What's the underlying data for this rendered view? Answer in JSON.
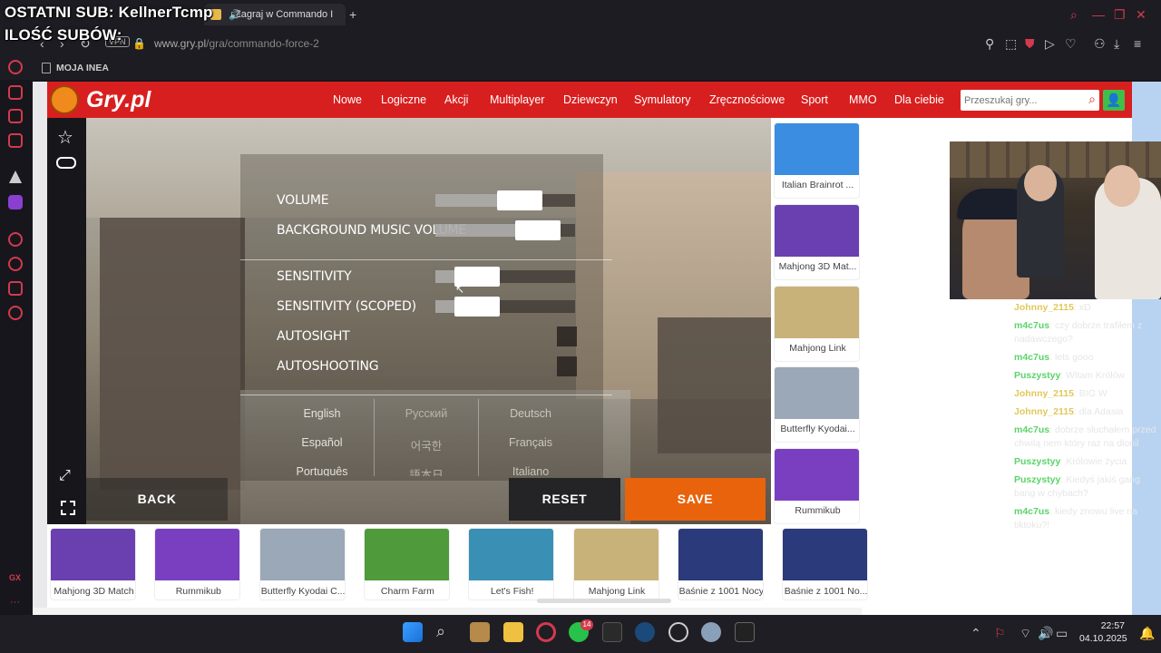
{
  "overlay": {
    "last_sub": "OSTATNI SUB: KellnerTcmp",
    "sub_count_label": "ILOŚĆ SUBÓW:"
  },
  "browser": {
    "tabs": [
      {
        "label": "Zagraj w Commando I"
      }
    ],
    "vpn_label": "VPN",
    "url_host": "www.gry.pl",
    "url_path": "/gra/commando-force-2",
    "bookmark": "MOJA INEA"
  },
  "site": {
    "logo": "Gry.pl",
    "nav": [
      "Nowe",
      "Logiczne",
      "Akcji",
      "Multiplayer",
      "Dziewczyn",
      "Symulatory",
      "Zręcznościowe",
      "Sport",
      "MMO",
      "Dla ciebie"
    ],
    "search_placeholder": "Przeszukaj gry..."
  },
  "game": {
    "settings": [
      {
        "label": "VOLUME",
        "value": 0.65
      },
      {
        "label": "BACKGROUND MUSIC VOLUME",
        "value": 0.85
      },
      {
        "label": "SENSITIVITY",
        "value": 0.2
      },
      {
        "label": "SENSITIVITY (SCOPED)",
        "value": 0.2
      }
    ],
    "toggles": [
      {
        "label": "AUTOSIGHT"
      },
      {
        "label": "AUTOSHOOTING"
      }
    ],
    "languages": [
      [
        "English",
        "Русский",
        "Deutsch"
      ],
      [
        "Español",
        "어국한",
        "Français"
      ],
      [
        "Português",
        "語本日",
        "Italiano"
      ]
    ],
    "back": "BACK",
    "reset": "RESET",
    "save": "SAVE"
  },
  "sidebar_games": [
    {
      "title": "Italian Brainrot ...",
      "color": "#3a8de0"
    },
    {
      "title": "Mahjong 3D Mat...",
      "color": "#6a3fb0"
    },
    {
      "title": "Mahjong Link",
      "color": "#c8b27a"
    },
    {
      "title": "Butterfly Kyodai...",
      "color": "#9aa8b8"
    },
    {
      "title": "Rummikub",
      "color": "#7a3fc0"
    }
  ],
  "bottom_games": [
    {
      "title": "Mahjong 3D Match",
      "color": "#6a3fb0"
    },
    {
      "title": "Rummikub",
      "color": "#7a3fc0"
    },
    {
      "title": "Butterfly Kyodai C...",
      "color": "#9aa8b8"
    },
    {
      "title": "Charm Farm",
      "color": "#4f9a3a"
    },
    {
      "title": "Let's Fish!",
      "color": "#3a8fb5"
    },
    {
      "title": "Mahjong Link",
      "color": "#c8b27a"
    },
    {
      "title": "Baśnie z 1001 Nocy",
      "color": "#2a3a7a"
    },
    {
      "title": "Baśnie z 1001 No...",
      "color": "#2a3a7a"
    }
  ],
  "chat": [
    {
      "user": "Johnny_2115",
      "user_color": "#e0c85a",
      "msg": ": xD"
    },
    {
      "user": "m4c7us",
      "user_color": "#5bd46a",
      "msg": ": czy dobrze trafiłem z nadawczego?"
    },
    {
      "user": "m4c7us",
      "user_color": "#5bd46a",
      "msg": ": lets gooo"
    },
    {
      "user": "Puszystyy",
      "user_color": "#5bd46a",
      "msg": ": Witam Królów"
    },
    {
      "user": "Johnny_2115",
      "user_color": "#e0c85a",
      "msg": ": BIG W"
    },
    {
      "user": "Johnny_2115",
      "user_color": "#e0c85a",
      "msg": ": dla Adasia"
    },
    {
      "user": "m4c7us",
      "user_color": "#5bd46a",
      "msg": ": dobrze słuchałem przed chwilą nem który raz na dlonil"
    },
    {
      "user": "Puszystyy",
      "user_color": "#5bd46a",
      "msg": ": Królowie życia"
    },
    {
      "user": "Puszystyy",
      "user_color": "#5bd46a",
      "msg": ": Kiedyś jakiś gang bang w chybach?"
    },
    {
      "user": "m4c7us",
      "user_color": "#5bd46a",
      "msg": ": kiedy znowu live na tiktoku?!"
    }
  ],
  "taskbar": {
    "time": "22:57",
    "date": "04.10.2025",
    "whatsapp_badge": "14"
  },
  "colors": {
    "brand_red": "#d81f1f",
    "save_orange": "#e8630c",
    "opera_red": "#d33a4d"
  }
}
